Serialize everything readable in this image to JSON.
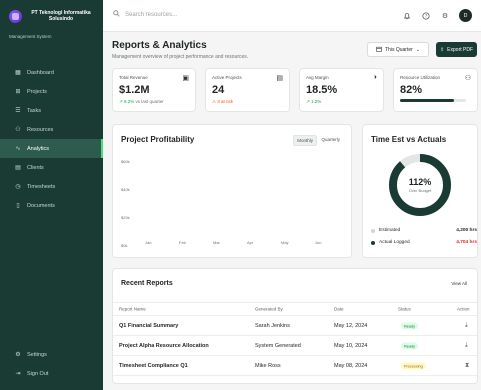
{
  "brand": {
    "name": "PT Teknologi Informatika Solusindo",
    "subtitle": "Management System"
  },
  "sidebar": {
    "items": [
      {
        "label": "Dashboard",
        "icon": "dashboard-icon",
        "glyph": "▦"
      },
      {
        "label": "Projects",
        "icon": "projects-icon",
        "glyph": "⊞"
      },
      {
        "label": "Tasks",
        "icon": "tasks-icon",
        "glyph": "☰"
      },
      {
        "label": "Resources",
        "icon": "users-icon",
        "glyph": "⚇"
      },
      {
        "label": "Analytics",
        "icon": "analytics-icon",
        "glyph": "∿",
        "active": true
      },
      {
        "label": "Clients",
        "icon": "building-icon",
        "glyph": "▤"
      },
      {
        "label": "Timesheets",
        "icon": "clock-icon",
        "glyph": "◷"
      },
      {
        "label": "Documents",
        "icon": "document-icon",
        "glyph": "▯"
      }
    ],
    "bottom": [
      {
        "label": "Settings",
        "icon": "gear-icon",
        "glyph": "⚙"
      },
      {
        "label": "Sign Out",
        "icon": "sign-out-icon",
        "glyph": "⇥"
      }
    ]
  },
  "topbar": {
    "search_placeholder": "Search resources...",
    "avatar_initial": "D"
  },
  "header": {
    "title": "Reports & Analytics",
    "subtitle": "Management overview of project performance and resources.",
    "period_button": "This Quarter",
    "export_button": "Export PDF"
  },
  "kpis": [
    {
      "label": "Total Revenue",
      "value": "$1.2M",
      "delta": "↗ 8.2%",
      "note": "vs last quarter",
      "icon": "money-icon",
      "glyph": "▣"
    },
    {
      "label": "Active Projects",
      "value": "24",
      "note": "⚠ 3 at risk",
      "icon": "clipboard-icon",
      "glyph": "▤"
    },
    {
      "label": "Avg Margin",
      "value": "18.5%",
      "delta": "↗ 1.2%",
      "icon": "pie-icon",
      "glyph": "◑"
    },
    {
      "label": "Resource Utilization",
      "value": "82%",
      "icon": "team-icon",
      "glyph": "⚇",
      "utilization": 0.82
    }
  ],
  "profitability": {
    "title": "Project Profitability",
    "toggle": [
      "Monthly",
      "Quarterly"
    ],
    "selected": "Monthly"
  },
  "chart_data": {
    "type": "bar",
    "title": "Project Profitability",
    "categories": [
      "Jan",
      "Feb",
      "Mar",
      "Apr",
      "May",
      "Jun"
    ],
    "yticks": [
      "$0k",
      "$20k",
      "$40k",
      "$60k"
    ],
    "series": []
  },
  "time_est": {
    "title": "Time Est vs Actuals",
    "percent": "112%",
    "percent_label": "Over Budget",
    "ratio": 0.887,
    "legend": [
      {
        "label": "Estimated",
        "value": "4,200 hrs",
        "color": "#d1d5d3",
        "value_color": "#1f2422"
      },
      {
        "label": "Actual Logged",
        "value": "4,704 hrs",
        "color": "#1a3b33",
        "value_color": "#dc2626"
      }
    ]
  },
  "reports": {
    "title": "Recent Reports",
    "view_all": "View All",
    "columns": [
      "Report Name",
      "Generated By",
      "Date",
      "Status",
      "Action"
    ],
    "rows": [
      {
        "name": "Q1 Financial Summary",
        "by": "Sarah Jenkins",
        "date": "May 12, 2024",
        "status": "Ready",
        "status_kind": "ready",
        "action_icon": "download-icon",
        "action_glyph": "⤓"
      },
      {
        "name": "Project Alpha Resource Allocation",
        "by": "System Generated",
        "date": "May 10, 2024",
        "status": "Ready",
        "status_kind": "ready",
        "action_icon": "download-icon",
        "action_glyph": "⤓"
      },
      {
        "name": "Timesheet Compliance Q1",
        "by": "Mike Ross",
        "date": "May 08, 2024",
        "status": "Processing",
        "status_kind": "proc",
        "action_icon": "hourglass-icon",
        "action_glyph": "⧗"
      }
    ]
  }
}
